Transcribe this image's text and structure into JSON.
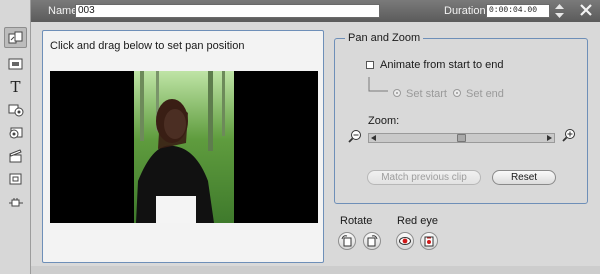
{
  "header": {
    "name_label": "Name:",
    "name_value": "003",
    "duration_label": "Duration:",
    "duration_value": "0:00:04.00"
  },
  "sidebar": {
    "tools": [
      {
        "icon": "pan-zoom-tool-icon",
        "active": true
      },
      {
        "icon": "video-properties-icon",
        "active": false
      },
      {
        "icon": "title-text-icon",
        "glyph": "T",
        "active": false
      },
      {
        "icon": "audio-effect-icon",
        "active": false
      },
      {
        "icon": "photo-effect-icon",
        "active": false
      },
      {
        "icon": "clapper-icon",
        "active": false
      },
      {
        "icon": "frame-icon",
        "active": false
      },
      {
        "icon": "plug-icon",
        "active": false
      }
    ]
  },
  "preview": {
    "instruction": "Click and drag below to set pan position"
  },
  "panzoom": {
    "title": "Pan and Zoom",
    "animate_label": "Animate from start to end",
    "set_start_label": "Set start",
    "set_end_label": "Set end",
    "zoom_label": "Zoom:",
    "zoom_level": 0.5,
    "match_button": "Match previous clip",
    "reset_button": "Reset"
  },
  "bottom": {
    "rotate_label": "Rotate",
    "redeye_label": "Red eye"
  },
  "colors": {
    "panel_border": "#6e8fb8",
    "titlebar": "#6a6a6a"
  }
}
